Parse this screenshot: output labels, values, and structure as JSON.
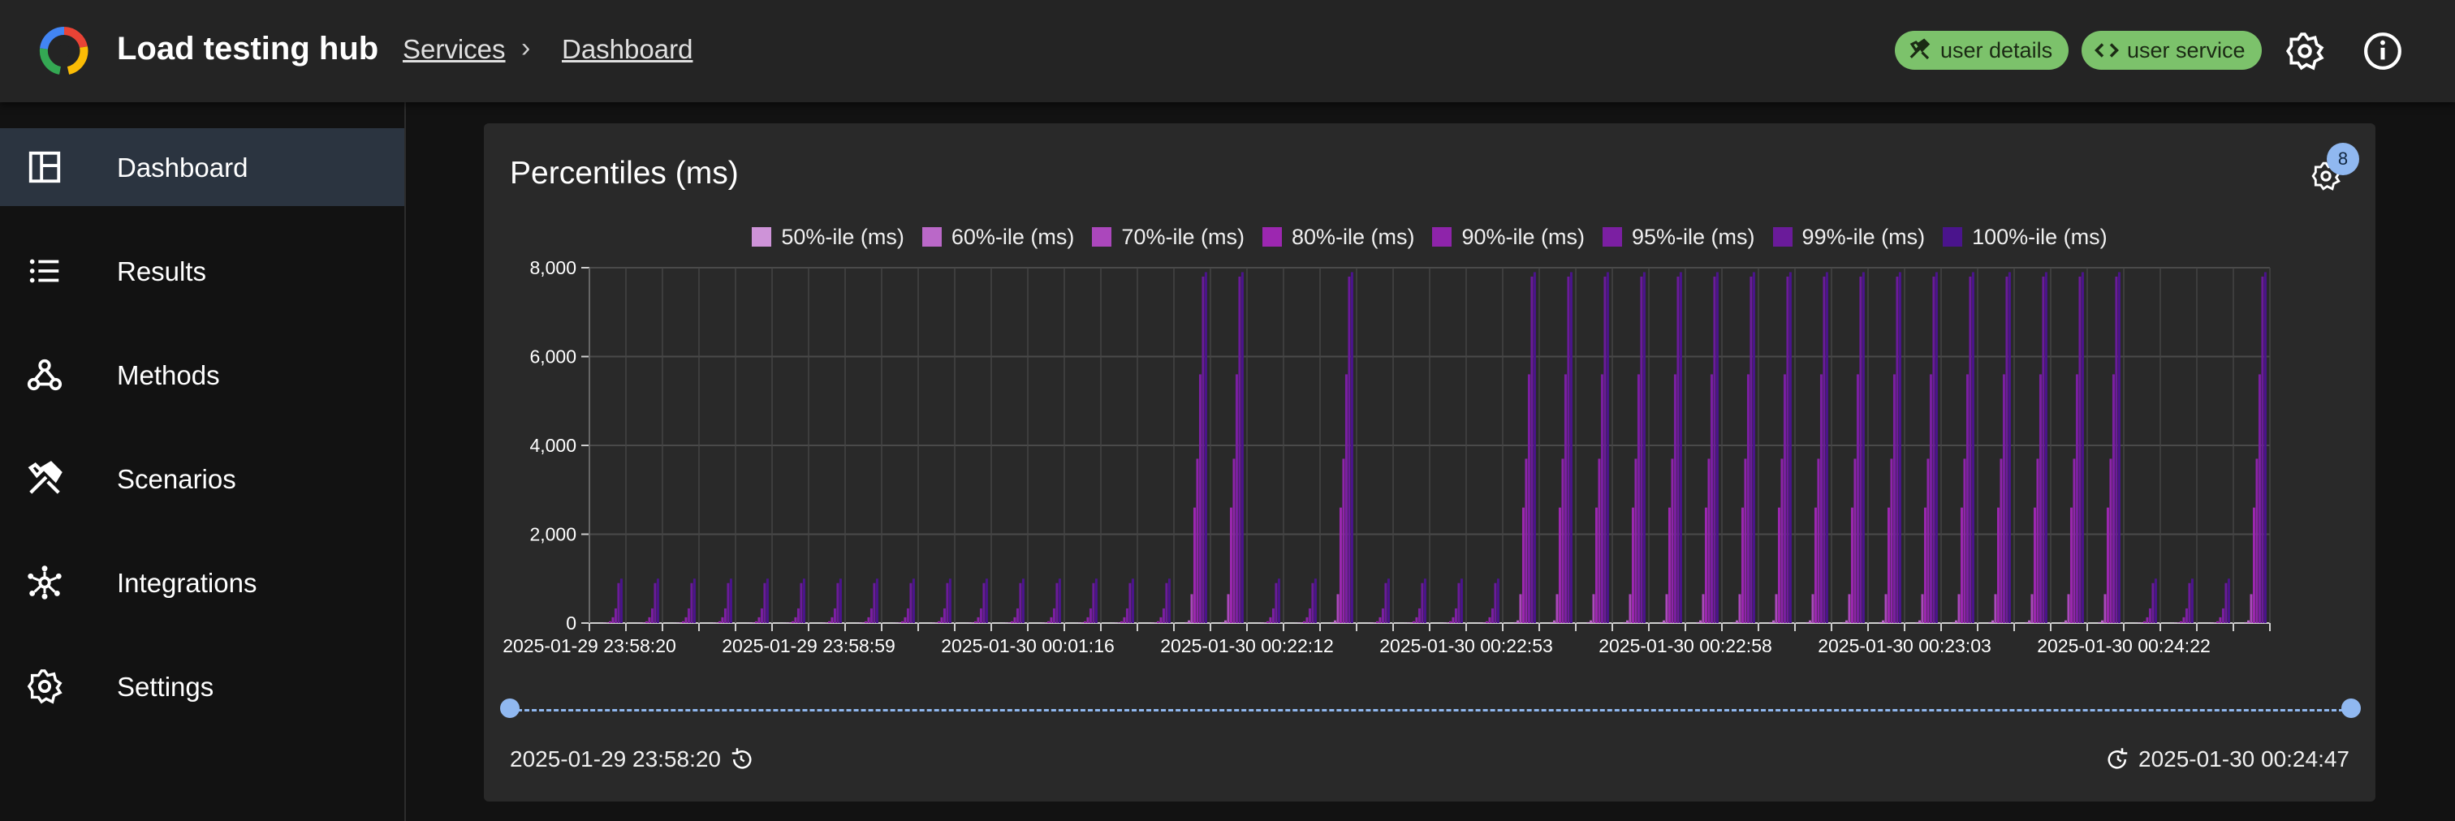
{
  "app": {
    "title": "Load testing hub"
  },
  "breadcrumb": {
    "items": [
      "Services",
      "Dashboard"
    ],
    "separator": "›"
  },
  "header": {
    "chips": [
      {
        "label": "user details",
        "icon": "hammer-icon"
      },
      {
        "label": "user service",
        "icon": "code-icon"
      }
    ],
    "icons": [
      "gear-icon",
      "info-icon"
    ]
  },
  "sidebar": {
    "items": [
      {
        "label": "Dashboard",
        "icon": "dashboard-icon",
        "active": true
      },
      {
        "label": "Results",
        "icon": "list-icon",
        "active": false
      },
      {
        "label": "Methods",
        "icon": "webhook-icon",
        "active": false
      },
      {
        "label": "Scenarios",
        "icon": "tools-icon",
        "active": false
      },
      {
        "label": "Integrations",
        "icon": "hub-icon",
        "active": false
      },
      {
        "label": "Settings",
        "icon": "gear-icon",
        "active": false
      }
    ]
  },
  "card": {
    "title": "Percentiles (ms)",
    "settings_badge": "8"
  },
  "range": {
    "start": "2025-01-29 23:58:20",
    "end": "2025-01-30 00:24:47"
  },
  "colors": {
    "accent": "#90b8f0",
    "chip": "#7cc26b",
    "active_nav": "#2b3440"
  },
  "chart_data": {
    "type": "bar",
    "title": "Percentiles (ms)",
    "xlabel": "",
    "ylabel": "",
    "ylim": [
      0,
      8000
    ],
    "yticks": [
      "0",
      "2,000",
      "4,000",
      "6,000",
      "8,000"
    ],
    "grid": true,
    "legend_position": "top",
    "categories": [
      "2025-01-29 23:58:20",
      "",
      "",
      "",
      "",
      "",
      "2025-01-29 23:58:59",
      "",
      "",
      "",
      "",
      "",
      "2025-01-30 00:01:16",
      "",
      "",
      "",
      "",
      "",
      "2025-01-30 00:22:12",
      "",
      "",
      "",
      "",
      "",
      "2025-01-30 00:22:53",
      "",
      "",
      "",
      "",
      "",
      "2025-01-30 00:22:58",
      "",
      "",
      "",
      "",
      "",
      "2025-01-30 00:23:03",
      "",
      "",
      "",
      "",
      "",
      "2025-01-30 00:24:22",
      "",
      "",
      ""
    ],
    "series": [
      {
        "name": "50%-ile (ms)",
        "color": "#ce93d8",
        "values": [
          3,
          3,
          3,
          3,
          3,
          3,
          3,
          3,
          3,
          3,
          3,
          3,
          3,
          3,
          3,
          3,
          20,
          20,
          3,
          3,
          20,
          3,
          3,
          3,
          3,
          20,
          20,
          20,
          20,
          20,
          20,
          20,
          20,
          20,
          20,
          20,
          20,
          20,
          20,
          20,
          20,
          20,
          3,
          3,
          3,
          20,
          3
        ]
      },
      {
        "name": "60%-ile (ms)",
        "color": "#ba68c8",
        "values": [
          5,
          5,
          5,
          5,
          5,
          5,
          5,
          5,
          5,
          5,
          5,
          5,
          5,
          5,
          5,
          5,
          60,
          60,
          5,
          5,
          60,
          5,
          5,
          5,
          5,
          60,
          60,
          60,
          60,
          60,
          60,
          60,
          60,
          60,
          60,
          60,
          60,
          60,
          60,
          60,
          60,
          60,
          5,
          5,
          5,
          60,
          5
        ]
      },
      {
        "name": "70%-ile (ms)",
        "color": "#ab47bc",
        "values": [
          10,
          10,
          10,
          10,
          10,
          10,
          10,
          10,
          10,
          10,
          10,
          10,
          10,
          10,
          10,
          10,
          650,
          650,
          10,
          10,
          650,
          10,
          10,
          10,
          10,
          650,
          650,
          650,
          650,
          650,
          650,
          650,
          650,
          650,
          650,
          650,
          650,
          650,
          650,
          650,
          650,
          650,
          10,
          10,
          10,
          650,
          10
        ]
      },
      {
        "name": "80%-ile (ms)",
        "color": "#9c27b0",
        "values": [
          40,
          40,
          40,
          40,
          40,
          40,
          40,
          40,
          40,
          40,
          40,
          40,
          40,
          40,
          40,
          40,
          2600,
          2600,
          40,
          40,
          2600,
          40,
          40,
          40,
          40,
          2600,
          2600,
          2600,
          2600,
          2600,
          2600,
          2600,
          2600,
          2600,
          2600,
          2600,
          2600,
          2600,
          2600,
          2600,
          2600,
          2600,
          40,
          40,
          40,
          2600,
          40
        ]
      },
      {
        "name": "90%-ile (ms)",
        "color": "#8e24aa",
        "values": [
          130,
          130,
          130,
          130,
          130,
          130,
          130,
          130,
          130,
          130,
          130,
          130,
          130,
          130,
          130,
          130,
          3700,
          3700,
          130,
          130,
          3700,
          130,
          130,
          130,
          130,
          3700,
          3700,
          3700,
          3700,
          3700,
          3700,
          3700,
          3700,
          3700,
          3700,
          3700,
          3700,
          3700,
          3700,
          3700,
          3700,
          3700,
          130,
          130,
          130,
          3700,
          130
        ]
      },
      {
        "name": "95%-ile (ms)",
        "color": "#7b1fa2",
        "values": [
          330,
          330,
          330,
          330,
          330,
          330,
          330,
          330,
          330,
          330,
          330,
          330,
          330,
          330,
          330,
          330,
          5600,
          5600,
          330,
          330,
          5600,
          330,
          330,
          330,
          330,
          5600,
          5600,
          5600,
          5600,
          5600,
          5600,
          5600,
          5600,
          5600,
          5600,
          5600,
          5600,
          5600,
          5600,
          5600,
          5600,
          5600,
          330,
          330,
          330,
          5600,
          330
        ]
      },
      {
        "name": "99%-ile (ms)",
        "color": "#6a1b9a",
        "values": [
          900,
          900,
          900,
          900,
          900,
          900,
          900,
          900,
          900,
          900,
          900,
          900,
          900,
          900,
          900,
          900,
          7800,
          7800,
          900,
          900,
          7800,
          900,
          900,
          900,
          900,
          7800,
          7800,
          7800,
          7800,
          7800,
          7800,
          7800,
          7800,
          7800,
          7800,
          7800,
          7800,
          7800,
          7800,
          7800,
          7800,
          7800,
          900,
          900,
          900,
          7800,
          900
        ]
      },
      {
        "name": "100%-ile (ms)",
        "color": "#4a148c",
        "values": [
          1000,
          1000,
          1000,
          1000,
          1000,
          1000,
          1000,
          1000,
          1000,
          1000,
          1000,
          1000,
          1000,
          1000,
          1000,
          1000,
          7900,
          7900,
          1000,
          1000,
          7900,
          1000,
          1000,
          1000,
          1000,
          7900,
          7900,
          7900,
          7900,
          7900,
          7900,
          7900,
          7900,
          7900,
          7900,
          7900,
          7900,
          7900,
          7900,
          7900,
          7900,
          7900,
          1000,
          1000,
          1000,
          7900,
          1000
        ]
      }
    ]
  }
}
